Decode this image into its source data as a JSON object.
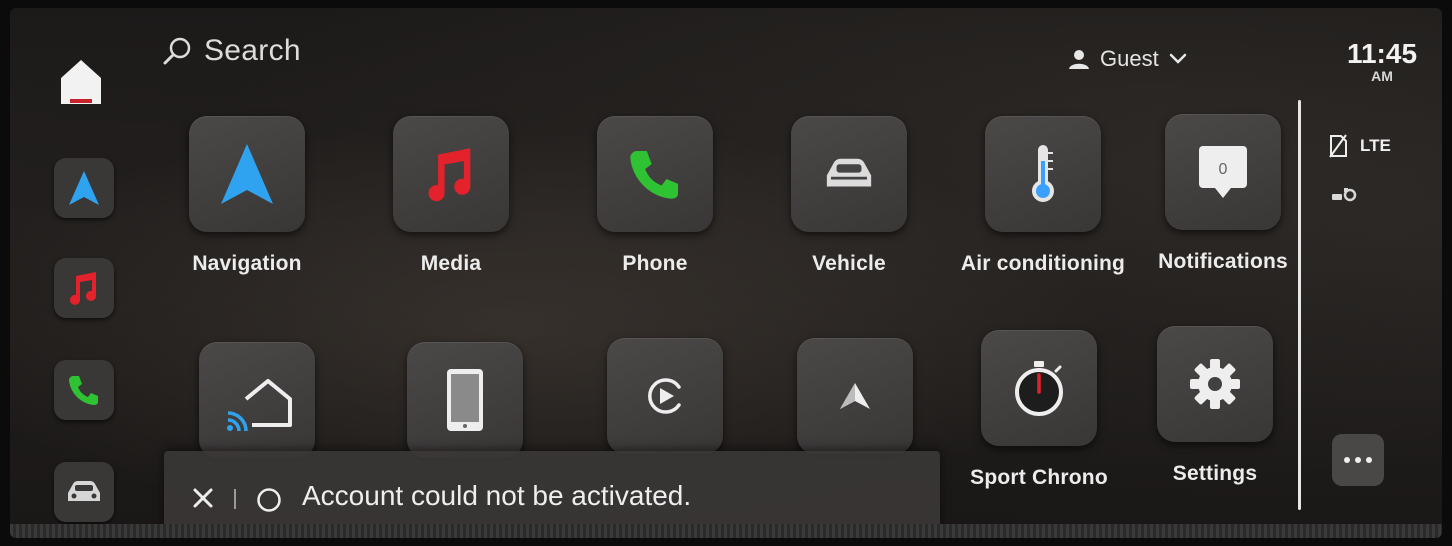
{
  "topbar": {
    "search_label": "Search",
    "profile_label": "Guest",
    "clock_time": "11:45",
    "clock_ampm": "AM"
  },
  "status": {
    "network_label": "LTE"
  },
  "apps_row1": [
    {
      "label": "Navigation",
      "icon": "navigation-arrow-icon",
      "color": "#2fa3f0"
    },
    {
      "label": "Media",
      "icon": "music-note-icon",
      "color": "#e4222b"
    },
    {
      "label": "Phone",
      "icon": "phone-handset-icon",
      "color": "#2fc233"
    },
    {
      "label": "Vehicle",
      "icon": "car-icon",
      "color": "#dcdcdc"
    },
    {
      "label": "Air conditioning",
      "icon": "thermometer-icon",
      "color": "#3aa0ff"
    },
    {
      "label": "Notifications",
      "icon": "notification-bubble-icon",
      "color": "#dcdcdc"
    }
  ],
  "apps_row2": [
    {
      "label": "",
      "icon": "smart-home-icon"
    },
    {
      "label": "",
      "icon": "tablet-icon"
    },
    {
      "label": "",
      "icon": "play-circle-icon"
    },
    {
      "label": "",
      "icon": "android-auto-icon"
    },
    {
      "label": "Sport Chrono",
      "icon": "stopwatch-icon"
    },
    {
      "label": "Settings",
      "icon": "gear-icon"
    }
  ],
  "notification_count": "0",
  "toast": {
    "message": "Account could not be activated."
  },
  "colors": {
    "accent_blue": "#2fa3f0",
    "accent_red": "#e4222b",
    "accent_green": "#2fc233"
  }
}
